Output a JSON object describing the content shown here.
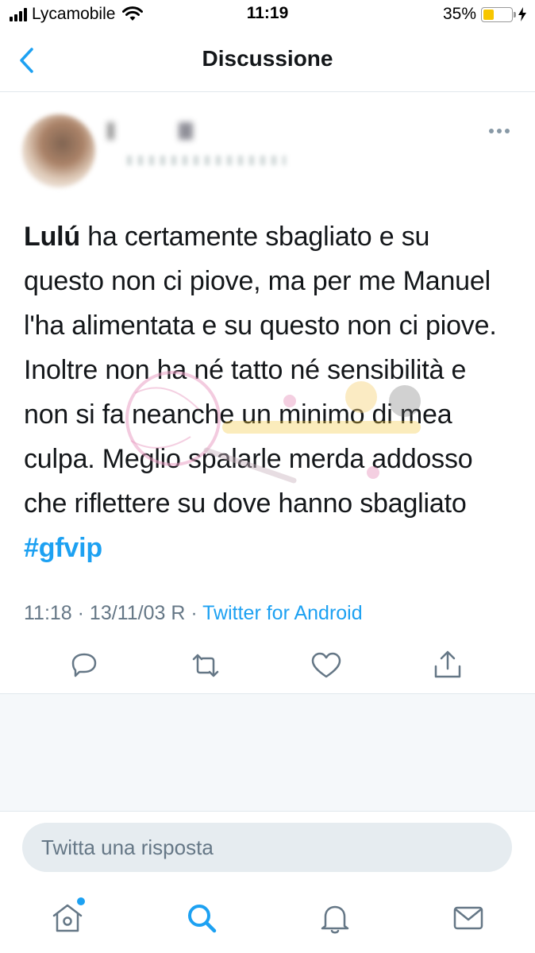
{
  "status_bar": {
    "carrier": "Lycamobile",
    "time": "11:19",
    "battery_percent_label": "35%",
    "battery_level": 0.35
  },
  "header": {
    "title": "Discussione",
    "back_icon": "chevron-left-icon"
  },
  "tweet": {
    "text_bold": "Lulú",
    "text_body": " ha certamente sbagliato e su questo non ci piove, ma per me Manuel l'ha alimentata e su questo non ci piove. Inoltre non ha né tatto né sensibilità e non si fa neanche un minimo di mea culpa. Meglio spalarle merda addosso che riflettere su dove hanno sbagliato ",
    "hashtag": "#gfvip",
    "timestamp": "11:18 · 13/11/03 R · ",
    "source": "Twitter for Android"
  },
  "actions": {
    "reply_icon": "reply-icon",
    "retweet_icon": "retweet-icon",
    "like_icon": "heart-icon",
    "share_icon": "share-icon"
  },
  "composer": {
    "placeholder": "Twitta una risposta"
  },
  "tabbar": {
    "items": [
      "home-icon",
      "search-icon",
      "bell-icon",
      "mail-icon"
    ]
  },
  "colors": {
    "accent": "#1da1f2",
    "text": "#14171a",
    "secondary": "#657786",
    "divider": "#e1e8ed"
  }
}
